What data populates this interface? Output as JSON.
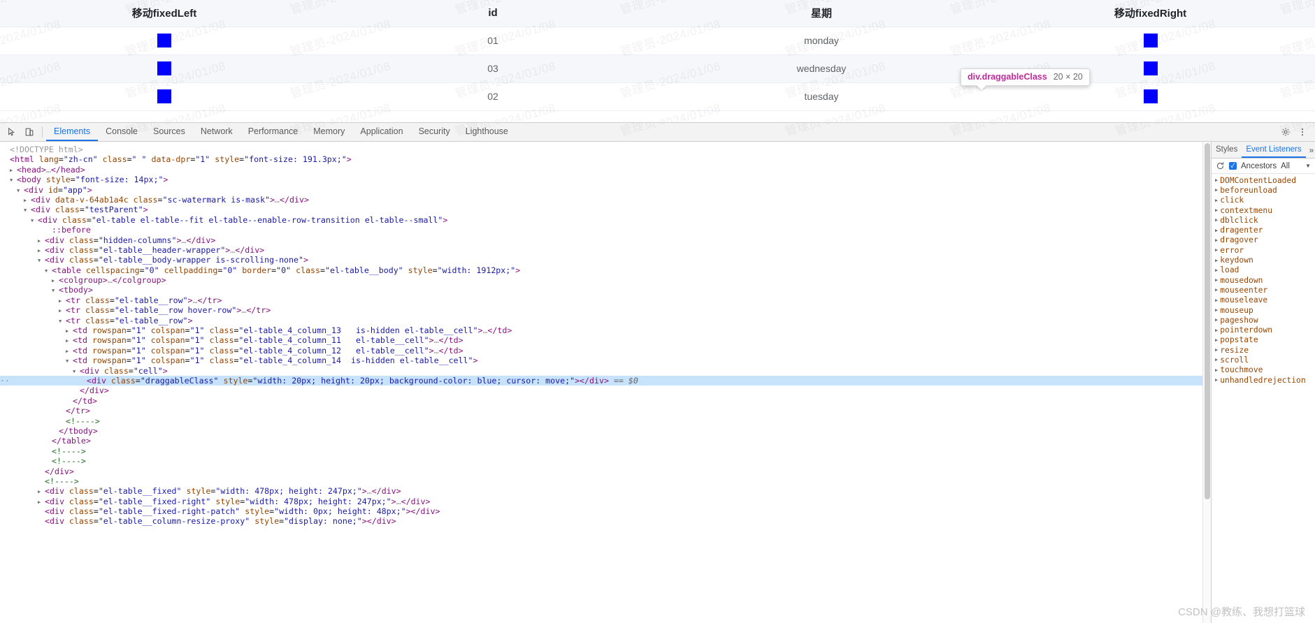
{
  "watermark": {
    "text": "管理员-2024/01/08"
  },
  "page": {
    "table": {
      "columns": [
        "移动fixedLeft",
        "id",
        "星期",
        "移动fixedRight"
      ],
      "rows": [
        {
          "left_handle": "",
          "id": "01",
          "week": "monday",
          "right_handle": ""
        },
        {
          "left_handle": "",
          "id": "03",
          "week": "wednesday",
          "right_handle": ""
        },
        {
          "left_handle": "",
          "id": "02",
          "week": "tuesday",
          "right_handle": ""
        }
      ],
      "handle_color": "#0000ff"
    },
    "inspect_tooltip": {
      "selector": "div.draggableClass",
      "dimensions": "20 × 20"
    }
  },
  "devtools": {
    "tabs": [
      "Elements",
      "Console",
      "Sources",
      "Network",
      "Performance",
      "Memory",
      "Application",
      "Security",
      "Lighthouse"
    ],
    "active_tab": "Elements",
    "icons": {
      "inspect": "inspect-picker-icon",
      "device": "device-toolbar-icon",
      "settings": "gear-icon",
      "more": "more-vertical-icon"
    },
    "dom_lines": [
      {
        "indent": 0,
        "twisty": "none",
        "html": "<span class=\"gray\">&lt;!DOCTYPE html&gt;</span>"
      },
      {
        "indent": 0,
        "twisty": "none",
        "html": "<span class=\"punct\">&lt;</span><span class=\"tag\">html</span> <span class=\"attr\">lang</span>=<span class=\"val\">\"zh-cn\"</span> <span class=\"attr\">class</span>=<span class=\"val\">\" \"</span> <span class=\"attr\">data-dpr</span>=<span class=\"val\">\"1\"</span> <span class=\"attr\">style</span>=<span class=\"val\">\"font-size: 191.3px;\"</span><span class=\"punct\">&gt;</span>"
      },
      {
        "indent": 1,
        "twisty": "closed",
        "html": "<span class=\"punct\">&lt;</span><span class=\"tag\">head</span><span class=\"punct\">&gt;</span><span class=\"gray\">…</span><span class=\"punct\">&lt;/</span><span class=\"tag\">head</span><span class=\"punct\">&gt;</span>"
      },
      {
        "indent": 1,
        "twisty": "open",
        "html": "<span class=\"punct\">&lt;</span><span class=\"tag\">body</span> <span class=\"attr\">style</span>=<span class=\"val\">\"font-size: 14px;\"</span><span class=\"punct\">&gt;</span>"
      },
      {
        "indent": 2,
        "twisty": "open",
        "html": "<span class=\"punct\">&lt;</span><span class=\"tag\">div</span> <span class=\"attr\">id</span>=<span class=\"val\">\"app\"</span><span class=\"punct\">&gt;</span>"
      },
      {
        "indent": 3,
        "twisty": "closed",
        "html": "<span class=\"punct\">&lt;</span><span class=\"tag\">div</span> <span class=\"attr\">data-v-64ab1a4c</span> <span class=\"attr\">class</span>=<span class=\"val\">\"sc-watermark is-mask\"</span><span class=\"punct\">&gt;</span><span class=\"gray\">…</span><span class=\"punct\">&lt;/</span><span class=\"tag\">div</span><span class=\"punct\">&gt;</span>"
      },
      {
        "indent": 3,
        "twisty": "open",
        "html": "<span class=\"punct\">&lt;</span><span class=\"tag\">div</span> <span class=\"attr\">class</span>=<span class=\"val\">\"testParent\"</span><span class=\"punct\">&gt;</span>"
      },
      {
        "indent": 4,
        "twisty": "open",
        "html": "<span class=\"punct\">&lt;</span><span class=\"tag\">div</span> <span class=\"attr\">class</span>=<span class=\"val\">\"el-table el-table--fit el-table--enable-row-transition el-table--small\"</span><span class=\"punct\">&gt;</span>"
      },
      {
        "indent": 6,
        "twisty": "none",
        "html": "<span class=\"pseudo\">::before</span>"
      },
      {
        "indent": 5,
        "twisty": "closed",
        "html": "<span class=\"punct\">&lt;</span><span class=\"tag\">div</span> <span class=\"attr\">class</span>=<span class=\"val\">\"hidden-columns\"</span><span class=\"punct\">&gt;</span><span class=\"gray\">…</span><span class=\"punct\">&lt;/</span><span class=\"tag\">div</span><span class=\"punct\">&gt;</span>"
      },
      {
        "indent": 5,
        "twisty": "closed",
        "html": "<span class=\"punct\">&lt;</span><span class=\"tag\">div</span> <span class=\"attr\">class</span>=<span class=\"val\">\"el-table__header-wrapper\"</span><span class=\"punct\">&gt;</span><span class=\"gray\">…</span><span class=\"punct\">&lt;/</span><span class=\"tag\">div</span><span class=\"punct\">&gt;</span>"
      },
      {
        "indent": 5,
        "twisty": "open",
        "html": "<span class=\"punct\">&lt;</span><span class=\"tag\">div</span> <span class=\"attr\">class</span>=<span class=\"val\">\"el-table__body-wrapper is-scrolling-none\"</span><span class=\"punct\">&gt;</span>"
      },
      {
        "indent": 6,
        "twisty": "open",
        "html": "<span class=\"punct\">&lt;</span><span class=\"tag\">table</span> <span class=\"attr\">cellspacing</span>=<span class=\"val\">\"0\"</span> <span class=\"attr\">cellpadding</span>=<span class=\"val\">\"0\"</span> <span class=\"attr\">border</span>=<span class=\"val\">\"0\"</span> <span class=\"attr\">class</span>=<span class=\"val\">\"el-table__body\"</span> <span class=\"attr\">style</span>=<span class=\"val\">\"width: 1912px;\"</span><span class=\"punct\">&gt;</span>"
      },
      {
        "indent": 7,
        "twisty": "closed",
        "html": "<span class=\"punct\">&lt;</span><span class=\"tag\">colgroup</span><span class=\"punct\">&gt;</span><span class=\"gray\">…</span><span class=\"punct\">&lt;/</span><span class=\"tag\">colgroup</span><span class=\"punct\">&gt;</span>"
      },
      {
        "indent": 7,
        "twisty": "open",
        "html": "<span class=\"punct\">&lt;</span><span class=\"tag\">tbody</span><span class=\"punct\">&gt;</span>"
      },
      {
        "indent": 8,
        "twisty": "closed",
        "html": "<span class=\"punct\">&lt;</span><span class=\"tag\">tr</span> <span class=\"attr\">class</span>=<span class=\"val\">\"el-table__row\"</span><span class=\"punct\">&gt;</span><span class=\"gray\">…</span><span class=\"punct\">&lt;/</span><span class=\"tag\">tr</span><span class=\"punct\">&gt;</span>"
      },
      {
        "indent": 8,
        "twisty": "closed",
        "html": "<span class=\"punct\">&lt;</span><span class=\"tag\">tr</span> <span class=\"attr\">class</span>=<span class=\"val\">\"el-table__row hover-row\"</span><span class=\"punct\">&gt;</span><span class=\"gray\">…</span><span class=\"punct\">&lt;/</span><span class=\"tag\">tr</span><span class=\"punct\">&gt;</span>"
      },
      {
        "indent": 8,
        "twisty": "open",
        "html": "<span class=\"punct\">&lt;</span><span class=\"tag\">tr</span> <span class=\"attr\">class</span>=<span class=\"val\">\"el-table__row\"</span><span class=\"punct\">&gt;</span>"
      },
      {
        "indent": 9,
        "twisty": "closed",
        "html": "<span class=\"punct\">&lt;</span><span class=\"tag\">td</span> <span class=\"attr\">rowspan</span>=<span class=\"val\">\"1\"</span> <span class=\"attr\">colspan</span>=<span class=\"val\">\"1\"</span> <span class=\"attr\">class</span>=<span class=\"val\">\"el-table_4_column_13   is-hidden el-table__cell\"</span><span class=\"punct\">&gt;</span><span class=\"gray\">…</span><span class=\"punct\">&lt;/</span><span class=\"tag\">td</span><span class=\"punct\">&gt;</span>"
      },
      {
        "indent": 9,
        "twisty": "closed",
        "html": "<span class=\"punct\">&lt;</span><span class=\"tag\">td</span> <span class=\"attr\">rowspan</span>=<span class=\"val\">\"1\"</span> <span class=\"attr\">colspan</span>=<span class=\"val\">\"1\"</span> <span class=\"attr\">class</span>=<span class=\"val\">\"el-table_4_column_11   el-table__cell\"</span><span class=\"punct\">&gt;</span><span class=\"gray\">…</span><span class=\"punct\">&lt;/</span><span class=\"tag\">td</span><span class=\"punct\">&gt;</span>"
      },
      {
        "indent": 9,
        "twisty": "closed",
        "html": "<span class=\"punct\">&lt;</span><span class=\"tag\">td</span> <span class=\"attr\">rowspan</span>=<span class=\"val\">\"1\"</span> <span class=\"attr\">colspan</span>=<span class=\"val\">\"1\"</span> <span class=\"attr\">class</span>=<span class=\"val\">\"el-table_4_column_12   el-table__cell\"</span><span class=\"punct\">&gt;</span><span class=\"gray\">…</span><span class=\"punct\">&lt;/</span><span class=\"tag\">td</span><span class=\"punct\">&gt;</span>"
      },
      {
        "indent": 9,
        "twisty": "open",
        "html": "<span class=\"punct\">&lt;</span><span class=\"tag\">td</span> <span class=\"attr\">rowspan</span>=<span class=\"val\">\"1\"</span> <span class=\"attr\">colspan</span>=<span class=\"val\">\"1\"</span> <span class=\"attr\">class</span>=<span class=\"val\">\"el-table_4_column_14  is-hidden el-table__cell\"</span><span class=\"punct\">&gt;</span>"
      },
      {
        "indent": 10,
        "twisty": "open",
        "html": "<span class=\"punct\">&lt;</span><span class=\"tag\">div</span> <span class=\"attr\">class</span>=<span class=\"val\">\"cell\"</span><span class=\"punct\">&gt;</span>"
      },
      {
        "indent": 11,
        "twisty": "none",
        "selected": true,
        "html": "<span class=\"punct\">&lt;</span><span class=\"tag\">div</span> <span class=\"attr\">class</span>=<span class=\"val\">\"draggableClass\"</span> <span class=\"attr\">style</span>=<span class=\"val\">\"width: 20px; height: 20px; background-color: blue; cursor: move;\"</span><span class=\"punct\">&gt;&lt;/</span><span class=\"tag\">div</span><span class=\"punct\">&gt;</span> <span class=\"eqsel\">== $0</span>"
      },
      {
        "indent": 10,
        "twisty": "none",
        "html": "<span class=\"punct\">&lt;/</span><span class=\"tag\">div</span><span class=\"punct\">&gt;</span>"
      },
      {
        "indent": 9,
        "twisty": "none",
        "html": "<span class=\"punct\">&lt;/</span><span class=\"tag\">td</span><span class=\"punct\">&gt;</span>"
      },
      {
        "indent": 8,
        "twisty": "none",
        "html": "<span class=\"punct\">&lt;/</span><span class=\"tag\">tr</span><span class=\"punct\">&gt;</span>"
      },
      {
        "indent": 8,
        "twisty": "none",
        "html": "<span class=\"com\">&lt;!----&gt;</span>"
      },
      {
        "indent": 7,
        "twisty": "none",
        "html": "<span class=\"punct\">&lt;/</span><span class=\"tag\">tbody</span><span class=\"punct\">&gt;</span>"
      },
      {
        "indent": 6,
        "twisty": "none",
        "html": "<span class=\"punct\">&lt;/</span><span class=\"tag\">table</span><span class=\"punct\">&gt;</span>"
      },
      {
        "indent": 6,
        "twisty": "none",
        "html": "<span class=\"com\">&lt;!----&gt;</span>"
      },
      {
        "indent": 6,
        "twisty": "none",
        "html": "<span class=\"com\">&lt;!----&gt;</span>"
      },
      {
        "indent": 5,
        "twisty": "none",
        "html": "<span class=\"punct\">&lt;/</span><span class=\"tag\">div</span><span class=\"punct\">&gt;</span>"
      },
      {
        "indent": 5,
        "twisty": "none",
        "html": "<span class=\"com\">&lt;!----&gt;</span>"
      },
      {
        "indent": 5,
        "twisty": "closed",
        "html": "<span class=\"punct\">&lt;</span><span class=\"tag\">div</span> <span class=\"attr\">class</span>=<span class=\"val\">\"el-table__fixed\"</span> <span class=\"attr\">style</span>=<span class=\"val\">\"width: 478px; height: 247px;\"</span><span class=\"punct\">&gt;</span><span class=\"gray\">…</span><span class=\"punct\">&lt;/</span><span class=\"tag\">div</span><span class=\"punct\">&gt;</span>"
      },
      {
        "indent": 5,
        "twisty": "closed",
        "html": "<span class=\"punct\">&lt;</span><span class=\"tag\">div</span> <span class=\"attr\">class</span>=<span class=\"val\">\"el-table__fixed-right\"</span> <span class=\"attr\">style</span>=<span class=\"val\">\"width: 478px; height: 247px;\"</span><span class=\"punct\">&gt;</span><span class=\"gray\">…</span><span class=\"punct\">&lt;/</span><span class=\"tag\">div</span><span class=\"punct\">&gt;</span>"
      },
      {
        "indent": 5,
        "twisty": "none",
        "html": "<span class=\"punct\">&lt;</span><span class=\"tag\">div</span> <span class=\"attr\">class</span>=<span class=\"val\">\"el-table__fixed-right-patch\"</span> <span class=\"attr\">style</span>=<span class=\"val\">\"width: 0px; height: 48px;\"</span><span class=\"punct\">&gt;&lt;/</span><span class=\"tag\">div</span><span class=\"punct\">&gt;</span>"
      },
      {
        "indent": 5,
        "twisty": "none",
        "html": "<span class=\"punct\">&lt;</span><span class=\"tag\">div</span> <span class=\"attr\">class</span>=<span class=\"val\">\"el-table__column-resize-proxy\"</span> <span class=\"attr\">style</span>=<span class=\"val\">\"display: none;\"</span><span class=\"punct\">&gt;&lt;/</span><span class=\"tag\">div</span><span class=\"punct\">&gt;</span>"
      }
    ],
    "sidebar": {
      "tabs": [
        "Styles",
        "Event Listeners"
      ],
      "active_tab": "Event Listeners",
      "more_label": "»",
      "controls": {
        "refresh": "refresh-icon",
        "ancestors_label": "Ancestors",
        "ancestors_checked": true,
        "filter_value": "All",
        "caret": "chevron-down-icon"
      },
      "events": [
        "DOMContentLoaded",
        "beforeunload",
        "click",
        "contextmenu",
        "dblclick",
        "dragenter",
        "dragover",
        "error",
        "keydown",
        "load",
        "mousedown",
        "mouseenter",
        "mouseleave",
        "mouseup",
        "pageshow",
        "pointerdown",
        "popstate",
        "resize",
        "scroll",
        "touchmove",
        "unhandledrejection"
      ]
    }
  },
  "footer_watermark": {
    "text": "CSDN @教练、我想打篮球"
  }
}
